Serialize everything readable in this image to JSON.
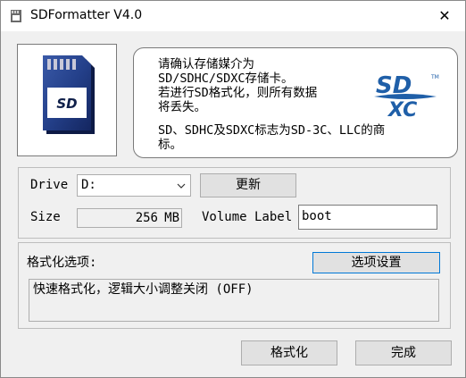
{
  "window": {
    "title": "SDFormatter V4.0",
    "close_glyph": "✕"
  },
  "info": {
    "line1": "请确认存储媒介为\nSD/SDHC/SDXC存储卡。",
    "line2": "若进行SD格式化，则所有数据\n将丢失。",
    "line3": "SD、SDHC及SDXC标志为SD-3C、LLC的商\n标。",
    "logo_text_sd": "SD",
    "logo_text_xc": "XC",
    "logo_tm": "TM"
  },
  "card": {
    "label": "SD"
  },
  "drive": {
    "label": "Drive",
    "value": "D:",
    "refresh_label": "更新"
  },
  "size": {
    "label": "Size",
    "value": "256",
    "unit": "MB"
  },
  "volume": {
    "label": "Volume Label",
    "value": "boot"
  },
  "options": {
    "label": "格式化选项:",
    "button_label": "选项设置",
    "summary": "快速格式化，逻辑大小调整关闭 (OFF)"
  },
  "actions": {
    "format_label": "格式化",
    "finish_label": "完成"
  },
  "colors": {
    "logo_blue": "#1f5fa8",
    "accent": "#0078d7"
  }
}
